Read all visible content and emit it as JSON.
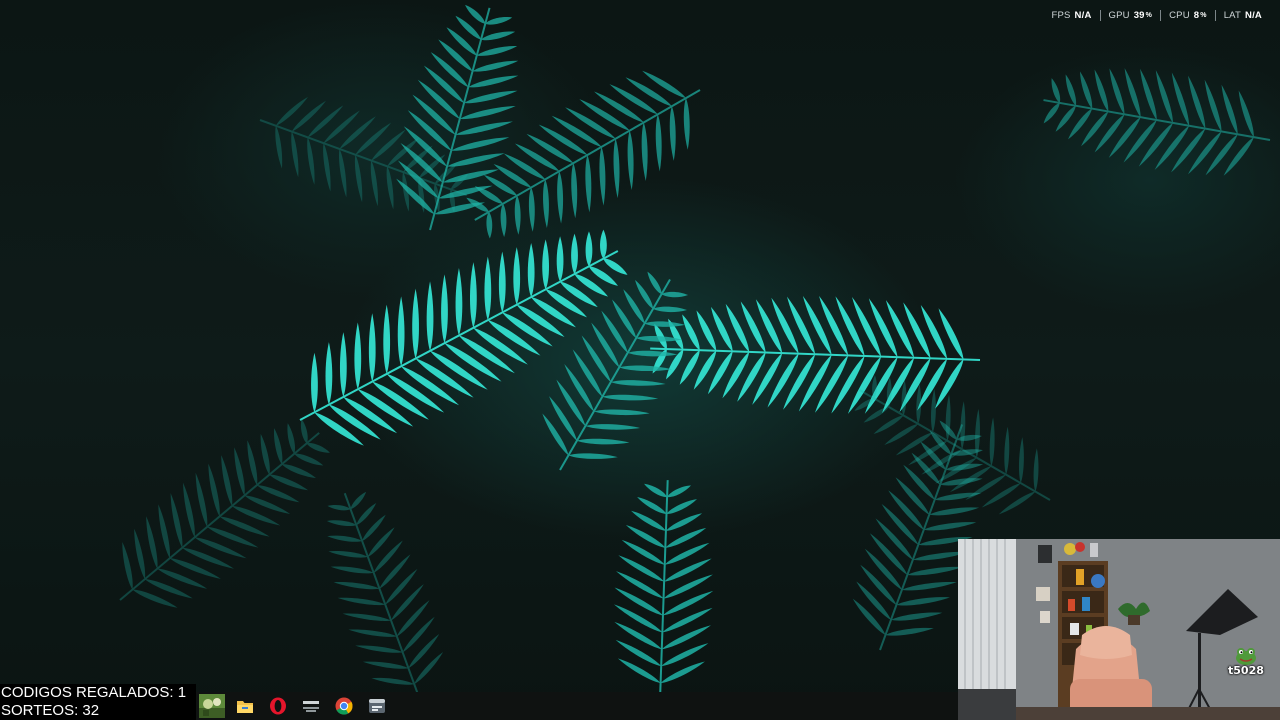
{
  "perf_overlay": {
    "fps_label": "FPS",
    "fps_value": "N/A",
    "gpu_label": "GPU",
    "gpu_value": "39",
    "gpu_unit": "%",
    "cpu_label": "CPU",
    "cpu_value": "8",
    "cpu_unit": "%",
    "lat_label": "LAT",
    "lat_value": "N/A"
  },
  "counters": {
    "codes": "CODIGOS REGALADOS: 1",
    "raffles": "SORTEOS: 32"
  },
  "taskbar": {
    "pinned": [
      {
        "name": "game-app-icon"
      },
      {
        "name": "file-explorer-icon"
      },
      {
        "name": "opera-icon"
      },
      {
        "name": "app-shortcut-icon"
      },
      {
        "name": "chrome-icon"
      },
      {
        "name": "window-app-icon"
      }
    ]
  },
  "webcam": {
    "badge_text": "t5028"
  },
  "colors": {
    "fern": "#1fb3a6",
    "fern_bright": "#33e0cf",
    "background": "#0d1715",
    "taskbar": "#0f1211"
  }
}
